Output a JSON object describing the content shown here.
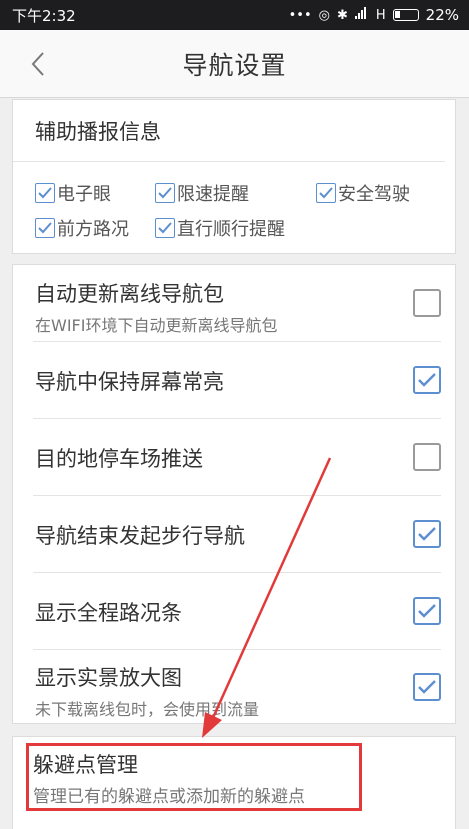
{
  "status_bar": {
    "time": "下午2:32",
    "network": "H",
    "battery_pct": "22%"
  },
  "header": {
    "title": "导航设置",
    "back_icon": "chevron-left-icon"
  },
  "broadcast": {
    "title": "辅助播报信息",
    "options": [
      {
        "label": "电子眼",
        "checked": true
      },
      {
        "label": "限速提醒",
        "checked": true
      },
      {
        "label": "安全驾驶",
        "checked": true
      },
      {
        "label": "前方路况",
        "checked": true
      },
      {
        "label": "直行顺行提醒",
        "checked": true
      }
    ]
  },
  "settings": [
    {
      "label": "自动更新离线导航包",
      "sub": "在WIFI环境下自动更新离线导航包",
      "checked": false
    },
    {
      "label": "导航中保持屏幕常亮",
      "checked": true
    },
    {
      "label": "目的地停车场推送",
      "checked": false
    },
    {
      "label": "导航结束发起步行导航",
      "checked": true
    },
    {
      "label": "显示全程路况条",
      "checked": true
    },
    {
      "label": "显示实景放大图",
      "sub": "未下载离线包时，会使用到流量",
      "checked": true
    }
  ],
  "avoid": {
    "label": "躲避点管理",
    "sub": "管理已有的躲避点或添加新的躲避点"
  },
  "colors": {
    "accent": "#5c8fcf",
    "annotation": "#e23a3a"
  }
}
